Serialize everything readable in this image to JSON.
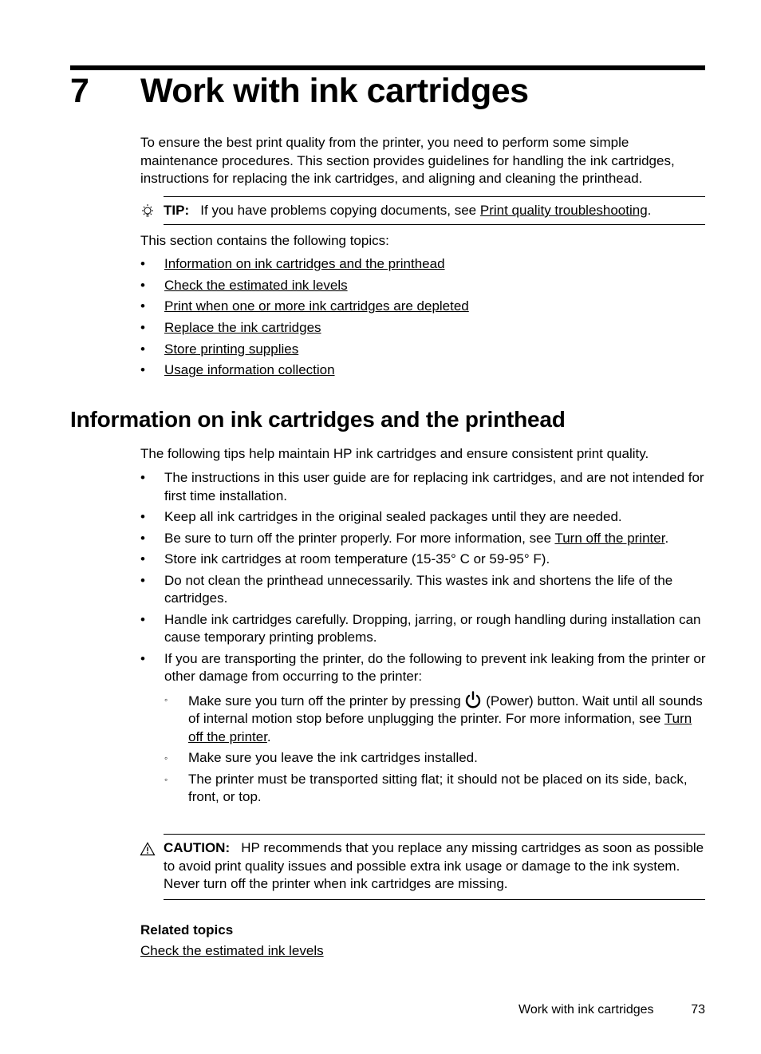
{
  "chapter": {
    "number": "7",
    "title": "Work with ink cartridges"
  },
  "intro": "To ensure the best print quality from the printer, you need to perform some simple maintenance procedures. This section provides guidelines for handling the ink cartridges, instructions for replacing the ink cartridges, and aligning and cleaning the printhead.",
  "tip": {
    "icon": "lightbulb-icon",
    "label": "TIP:",
    "text": "If you have problems copying documents, see ",
    "link": "Print quality troubleshooting",
    "end": "."
  },
  "topics_intro": "This section contains the following topics:",
  "topics": [
    "Information on ink cartridges and the printhead",
    "Check the estimated ink levels",
    "Print when one or more ink cartridges are depleted",
    "Replace the ink cartridges",
    "Store printing supplies",
    "Usage information collection"
  ],
  "section": {
    "title": "Information on ink cartridges and the printhead",
    "intro": "The following tips help maintain HP ink cartridges and ensure consistent print quality.",
    "tips": [
      {
        "text": "The instructions in this user guide are for replacing ink cartridges, and are not intended for first time installation."
      },
      {
        "text": "Keep all ink cartridges in the original sealed packages until they are needed."
      },
      {
        "text": "Be sure to turn off the printer properly. For more information, see ",
        "link": "Turn off the printer",
        "end": "."
      },
      {
        "text": "Store ink cartridges at room temperature (15-35° C or 59-95° F)."
      },
      {
        "text": "Do not clean the printhead unnecessarily. This wastes ink and shortens the life of the cartridges."
      },
      {
        "text": "Handle ink cartridges carefully. Dropping, jarring, or rough handling during installation can cause temporary printing problems."
      },
      {
        "text": "If you are transporting the printer, do the following to prevent ink leaking from the printer or other damage from occurring to the printer:"
      }
    ],
    "sub": {
      "first_a": "Make sure you turn off the printer by pressing ",
      "first_b": " (Power) button. Wait until all sounds of internal motion stop before unplugging the printer. For more information, see ",
      "first_link": "Turn off the printer",
      "first_end": ".",
      "second": "Make sure you leave the ink cartridges installed.",
      "third": "The printer must be transported sitting flat; it should not be placed on its side, back, front, or top."
    },
    "bullet": "•",
    "sub_bullet": "◦"
  },
  "caution": {
    "icon": "warning-triangle-icon",
    "label": "CAUTION:",
    "text": "HP recommends that you replace any missing cartridges as soon as possible to avoid print quality issues and possible extra ink usage or damage to the ink system. Never turn off the printer when ink cartridges are missing."
  },
  "related": {
    "heading": "Related topics",
    "link": "Check the estimated ink levels"
  },
  "footer": {
    "title": "Work with ink cartridges",
    "page": "73"
  }
}
